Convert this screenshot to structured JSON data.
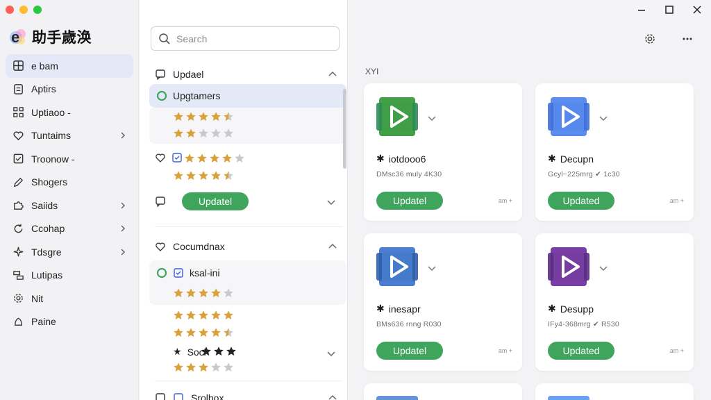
{
  "app": {
    "title": "助手歲涣"
  },
  "search": {
    "placeholder": "Search"
  },
  "sidebar": {
    "items": [
      {
        "label": "e bam",
        "icon": "dashboard-icon",
        "has_chevron": false
      },
      {
        "label": "Aptirs",
        "icon": "document-icon",
        "has_chevron": false
      },
      {
        "label": "Uptiaoo -",
        "icon": "grid-icon",
        "has_chevron": false
      },
      {
        "label": "Tuntaims",
        "icon": "heart-icon",
        "has_chevron": true
      },
      {
        "label": "Troonow -",
        "icon": "checkbox-icon",
        "has_chevron": false
      },
      {
        "label": "Shogers",
        "icon": "pen-icon",
        "has_chevron": false
      },
      {
        "label": "Saiids",
        "icon": "puzzle-icon",
        "has_chevron": true
      },
      {
        "label": "Ccohap",
        "icon": "refresh-icon",
        "has_chevron": true
      },
      {
        "label": "Tdsgre",
        "icon": "sparkle-icon",
        "has_chevron": true
      },
      {
        "label": "Lutipas",
        "icon": "layers-icon",
        "has_chevron": false
      },
      {
        "label": "Nit",
        "icon": "gear-icon",
        "has_chevron": false
      },
      {
        "label": "Paine",
        "icon": "bell-icon",
        "has_chevron": false
      }
    ]
  },
  "list": {
    "group1": {
      "title": "Updael",
      "row1_title": "Upgtamers",
      "row1_stars_a": 4.5,
      "row1_stars_b": 2,
      "row2_stars_a": 4,
      "row2_stars_b": 4.5,
      "row3_button": "Updatel"
    },
    "group2": {
      "title": "Cocumdnax",
      "row1_title": "ksal-ini",
      "row1_stars": 4,
      "stars_b": 5,
      "stars_c": 4.5,
      "row2_title": "Socl",
      "row2_stars_inline": 3,
      "row2_stars": 3
    },
    "group3": {
      "title": "Srolbox"
    }
  },
  "right": {
    "label": "XYI",
    "cards": [
      {
        "title": "iotdooo6",
        "meta": "DMsc36 muly 4K30",
        "button": "Updatel",
        "tag": "am +",
        "color_a": "#2e8b57",
        "color_b": "#43a047"
      },
      {
        "title": "Decupn",
        "meta": "Gcyl~225mrg ✔ 1c30",
        "button": "Updated",
        "tag": "am +",
        "color_a": "#3f6fd8",
        "color_b": "#5b8def"
      },
      {
        "title": "inesapr",
        "meta": "BMs636 rnng R030",
        "button": "Updatel",
        "tag": "am +",
        "color_a": "#2f5faa",
        "color_b": "#4a7fcf"
      },
      {
        "title": "Desupp",
        "meta": "IFy4-368mrg ✔ R530",
        "button": "Updated",
        "tag": "am +",
        "color_a": "#5b2c83",
        "color_b": "#7a3fa6"
      }
    ]
  },
  "colors": {
    "accent": "#3fa55d",
    "selection": "#e3e9f7",
    "star": "#d9a13a"
  }
}
